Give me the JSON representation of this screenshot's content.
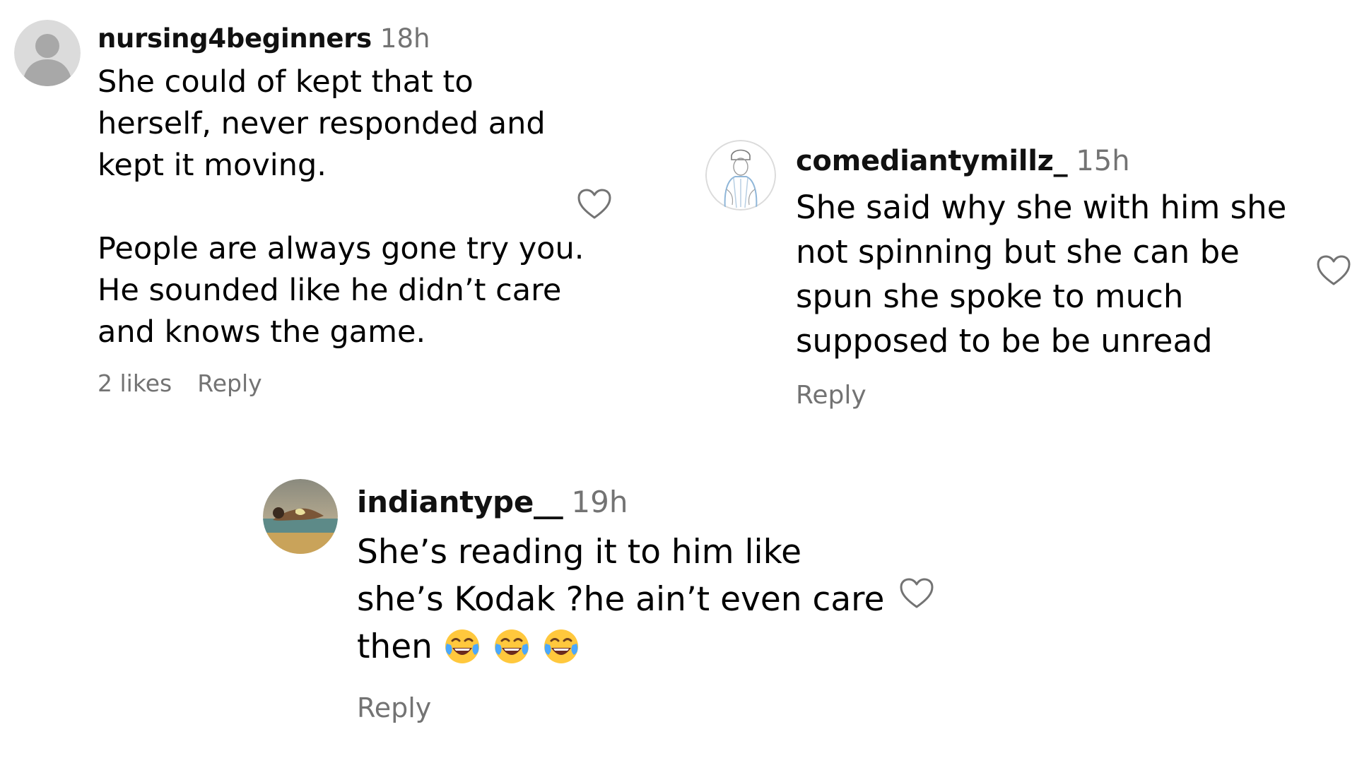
{
  "colors": {
    "text": "#000000",
    "username": "#111111",
    "muted": "#737373",
    "background": "#ffffff",
    "avatar_placeholder": "#dbdbdb",
    "avatar_silhouette": "#a8a8a8"
  },
  "comments": [
    {
      "username": "nursing4beginners",
      "time": "18h",
      "text": "She could of kept that to\nherself, never responded and\nkept it moving.\n\nPeople are always gone try you.\nHe sounded like he didn’t care\nand knows the game.",
      "likes": "2 likes",
      "reply_label": "Reply",
      "avatar_icon": "default-user-avatar-icon",
      "like_icon": "heart-outline-icon"
    },
    {
      "username": "comediantymillz_",
      "time": "15h",
      "text": "She said why she with him she\nnot spinning but she can be\nspun she spoke to much\nsupposed to be be unread",
      "reply_label": "Reply",
      "avatar_icon": "sketch-portrait-avatar-icon",
      "like_icon": "heart-outline-icon"
    },
    {
      "username": "indiantype__",
      "time": "19h",
      "text": "She’s reading it to him like\nshe’s Kodak ?he ain’t even care\nthen",
      "emojis": [
        "face-with-tears-of-joy-emoji",
        "face-with-tears-of-joy-emoji",
        "face-with-tears-of-joy-emoji"
      ],
      "reply_label": "Reply",
      "avatar_icon": "photo-avatar-icon",
      "like_icon": "heart-outline-icon"
    }
  ]
}
